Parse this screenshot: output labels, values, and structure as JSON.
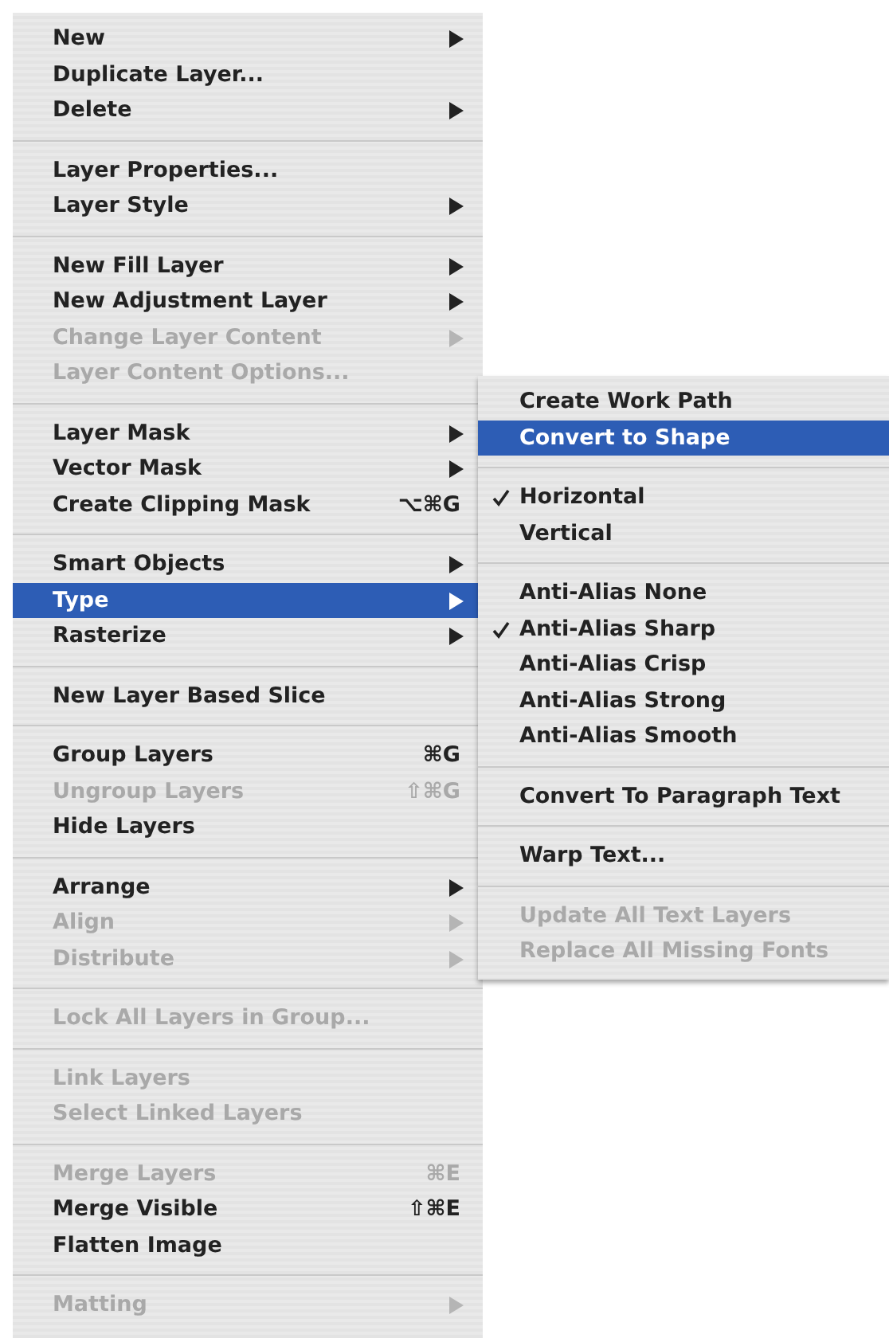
{
  "menu": {
    "groups": [
      [
        {
          "label": "New",
          "has_submenu": true,
          "disabled": false,
          "selected": false
        },
        {
          "label": "Duplicate Layer...",
          "has_submenu": false,
          "disabled": false,
          "selected": false
        },
        {
          "label": "Delete",
          "has_submenu": true,
          "disabled": false,
          "selected": false
        }
      ],
      [
        {
          "label": "Layer Properties...",
          "has_submenu": false,
          "disabled": false,
          "selected": false
        },
        {
          "label": "Layer Style",
          "has_submenu": true,
          "disabled": false,
          "selected": false
        }
      ],
      [
        {
          "label": "New Fill Layer",
          "has_submenu": true,
          "disabled": false,
          "selected": false
        },
        {
          "label": "New Adjustment Layer",
          "has_submenu": true,
          "disabled": false,
          "selected": false
        },
        {
          "label": "Change Layer Content",
          "has_submenu": true,
          "disabled": true,
          "selected": false
        },
        {
          "label": "Layer Content Options...",
          "has_submenu": false,
          "disabled": true,
          "selected": false
        }
      ],
      [
        {
          "label": "Layer Mask",
          "has_submenu": true,
          "disabled": false,
          "selected": false
        },
        {
          "label": "Vector Mask",
          "has_submenu": true,
          "disabled": false,
          "selected": false
        },
        {
          "label": "Create Clipping Mask",
          "shortcut": "⌥⌘G",
          "has_submenu": false,
          "disabled": false,
          "selected": false
        }
      ],
      [
        {
          "label": "Smart Objects",
          "has_submenu": true,
          "disabled": false,
          "selected": false
        },
        {
          "label": "Type",
          "has_submenu": true,
          "disabled": false,
          "selected": true
        },
        {
          "label": "Rasterize",
          "has_submenu": true,
          "disabled": false,
          "selected": false
        }
      ],
      [
        {
          "label": "New Layer Based Slice",
          "has_submenu": false,
          "disabled": false,
          "selected": false
        }
      ],
      [
        {
          "label": "Group Layers",
          "shortcut": "⌘G",
          "has_submenu": false,
          "disabled": false,
          "selected": false
        },
        {
          "label": "Ungroup Layers",
          "shortcut": "⇧⌘G",
          "has_submenu": false,
          "disabled": true,
          "selected": false
        },
        {
          "label": "Hide Layers",
          "has_submenu": false,
          "disabled": false,
          "selected": false
        }
      ],
      [
        {
          "label": "Arrange",
          "has_submenu": true,
          "disabled": false,
          "selected": false
        },
        {
          "label": "Align",
          "has_submenu": true,
          "disabled": true,
          "selected": false
        },
        {
          "label": "Distribute",
          "has_submenu": true,
          "disabled": true,
          "selected": false
        }
      ],
      [
        {
          "label": "Lock All Layers in Group...",
          "has_submenu": false,
          "disabled": true,
          "selected": false
        }
      ],
      [
        {
          "label": "Link Layers",
          "has_submenu": false,
          "disabled": true,
          "selected": false
        },
        {
          "label": "Select Linked Layers",
          "has_submenu": false,
          "disabled": true,
          "selected": false
        }
      ],
      [
        {
          "label": "Merge Layers",
          "shortcut": "⌘E",
          "has_submenu": false,
          "disabled": true,
          "selected": false
        },
        {
          "label": "Merge Visible",
          "shortcut": "⇧⌘E",
          "has_submenu": false,
          "disabled": false,
          "selected": false
        },
        {
          "label": "Flatten Image",
          "has_submenu": false,
          "disabled": false,
          "selected": false
        }
      ],
      [
        {
          "label": "Matting",
          "has_submenu": true,
          "disabled": true,
          "selected": false
        }
      ]
    ]
  },
  "submenu": {
    "groups": [
      [
        {
          "label": "Create Work Path",
          "checked": false,
          "disabled": false,
          "selected": false
        },
        {
          "label": "Convert to Shape",
          "checked": false,
          "disabled": false,
          "selected": true
        }
      ],
      [
        {
          "label": "Horizontal",
          "checked": true,
          "disabled": false,
          "selected": false
        },
        {
          "label": "Vertical",
          "checked": false,
          "disabled": false,
          "selected": false
        }
      ],
      [
        {
          "label": "Anti-Alias None",
          "checked": false,
          "disabled": false,
          "selected": false
        },
        {
          "label": "Anti-Alias Sharp",
          "checked": true,
          "disabled": false,
          "selected": false
        },
        {
          "label": "Anti-Alias Crisp",
          "checked": false,
          "disabled": false,
          "selected": false
        },
        {
          "label": "Anti-Alias Strong",
          "checked": false,
          "disabled": false,
          "selected": false
        },
        {
          "label": "Anti-Alias Smooth",
          "checked": false,
          "disabled": false,
          "selected": false
        }
      ],
      [
        {
          "label": "Convert To Paragraph Text",
          "checked": false,
          "disabled": false,
          "selected": false
        }
      ],
      [
        {
          "label": "Warp Text...",
          "checked": false,
          "disabled": false,
          "selected": false
        }
      ],
      [
        {
          "label": "Update All Text Layers",
          "checked": false,
          "disabled": true,
          "selected": false
        },
        {
          "label": "Replace All Missing Fonts",
          "checked": false,
          "disabled": true,
          "selected": false
        }
      ]
    ]
  }
}
